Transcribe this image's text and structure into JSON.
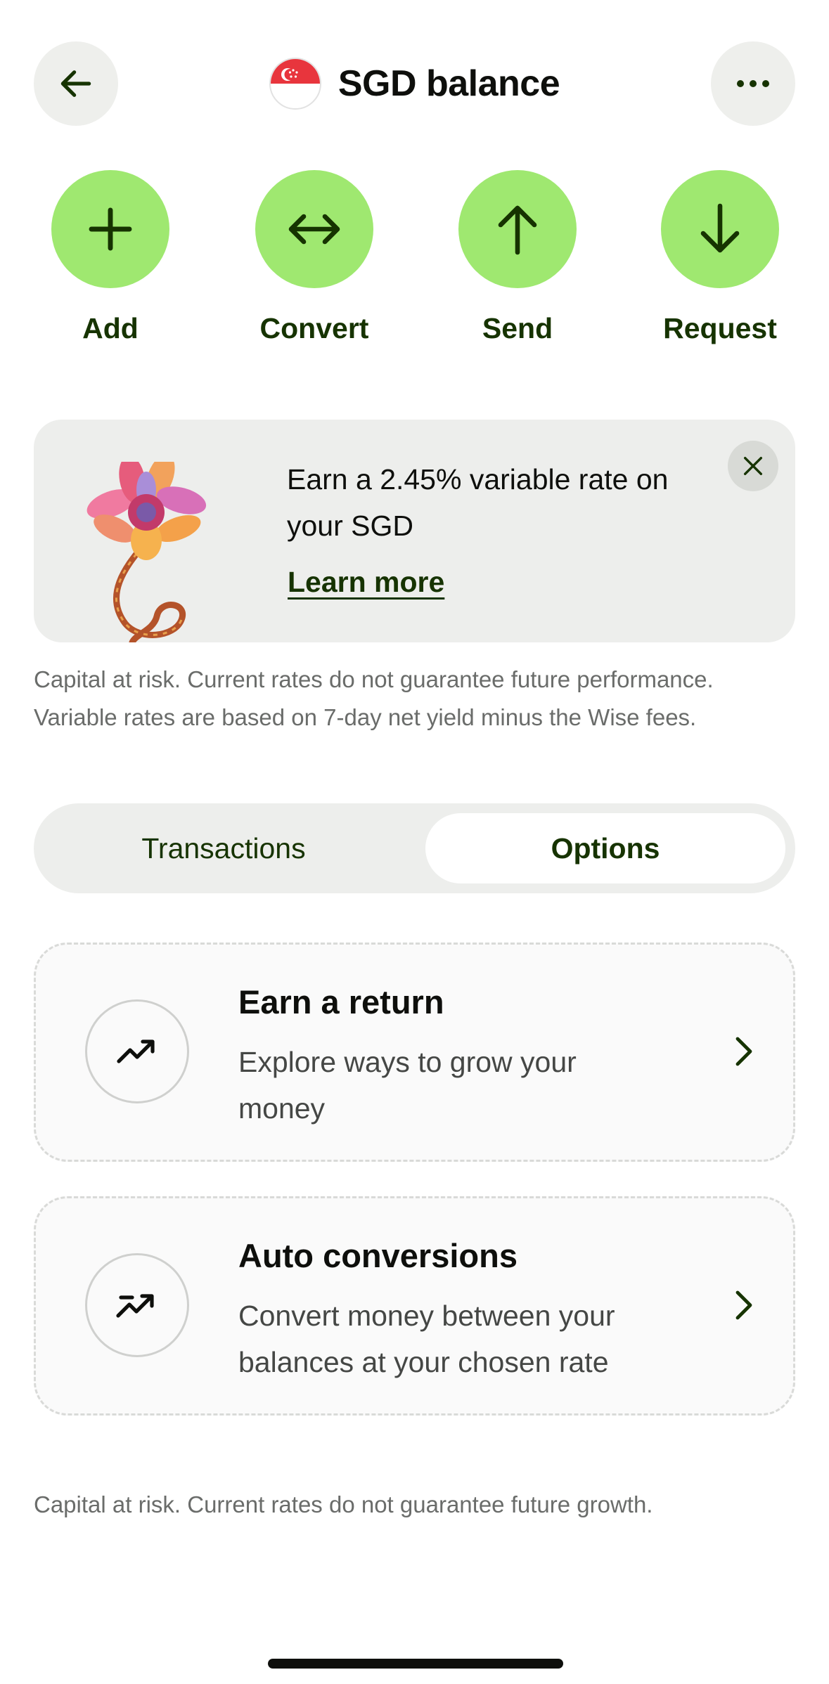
{
  "header": {
    "title": "SGD balance",
    "back_icon": "arrow-left-icon",
    "more_icon": "more-dots-icon",
    "flag_icon": "singapore-flag-icon"
  },
  "actions": [
    {
      "label": "Add",
      "icon": "plus-icon"
    },
    {
      "label": "Convert",
      "icon": "arrows-horizontal-icon"
    },
    {
      "label": "Send",
      "icon": "arrow-up-icon"
    },
    {
      "label": "Request",
      "icon": "arrow-down-icon"
    }
  ],
  "promo": {
    "text": "Earn a 2.45% variable rate on your SGD",
    "link": "Learn more",
    "image": "flower-illustration",
    "close_icon": "close-icon"
  },
  "disclaimer_top": "Capital at risk. Current rates do not guarantee future performance. Variable rates are based on 7-day net yield minus the Wise fees.",
  "tabs": {
    "items": [
      "Transactions",
      "Options"
    ],
    "selected": "Options"
  },
  "options": [
    {
      "title": "Earn a return",
      "description": "Explore ways to grow your money",
      "icon": "trending-up-icon"
    },
    {
      "title": "Auto conversions",
      "description": "Convert money between your balances at your chosen rate",
      "icon": "trending-up-target-icon"
    }
  ],
  "disclaimer_bottom": "Capital at risk. Current rates do not guarantee future growth.",
  "colors": {
    "accent_green": "#9fe870",
    "forest_green": "#163300",
    "surface_grey": "#edeeec",
    "text_primary": "#0e0f0c",
    "text_secondary": "#6a6c6a",
    "flag_red": "#e8353d"
  }
}
